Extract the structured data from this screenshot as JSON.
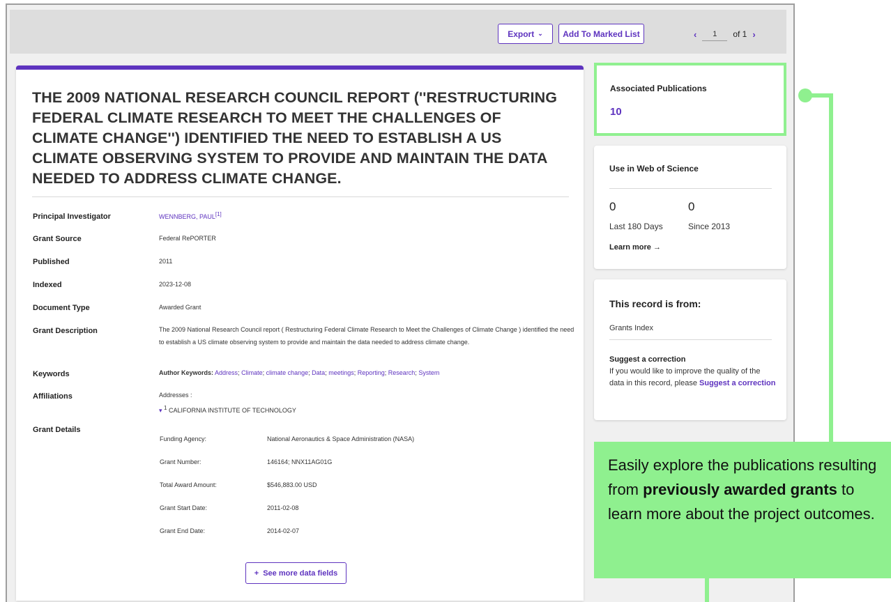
{
  "toolbar": {
    "export_label": "Export",
    "marked_list_label": "Add To Marked List",
    "page_current": "1",
    "page_total": "of 1"
  },
  "record": {
    "title": "THE 2009 NATIONAL RESEARCH COUNCIL REPORT (''RESTRUCTURING FEDERAL CLIMATE RESEARCH TO MEET THE CHALLENGES OF CLIMATE CHANGE'') IDENTIFIED THE NEED TO ESTABLISH A US CLIMATE OBSERVING SYSTEM TO PROVIDE AND MAINTAIN THE DATA NEEDED TO ADDRESS CLIMATE CHANGE.",
    "fields": {
      "pi_label": "Principal Investigator",
      "pi_value": "WENNBERG, PAUL",
      "pi_sup": "[1]",
      "source_label": "Grant Source",
      "source_value": "Federal RePORTER",
      "published_label": "Published",
      "published_value": "2011",
      "indexed_label": "Indexed",
      "indexed_value": "2023-12-08",
      "doctype_label": "Document Type",
      "doctype_value": "Awarded Grant",
      "desc_label": "Grant Description",
      "desc_value": "The 2009 National Research Council report ( Restructuring Federal Climate Research to Meet the Challenges of Climate Change ) identified the need to establish a US climate observing system to provide and maintain the data needed to address climate change.",
      "keywords_label": "Keywords",
      "keywords_prefix": "Author Keywords:",
      "keywords": [
        "Address",
        "Climate",
        "climate change",
        "Data",
        "meetings",
        "Reporting",
        "Research",
        "System"
      ],
      "affiliations_label": "Affiliations",
      "addresses_label": "Addresses :",
      "address_num": "1",
      "address_value": "CALIFORNIA INSTITUTE OF TECHNOLOGY",
      "grant_details_label": "Grant Details"
    },
    "grant_details": {
      "agency_label": "Funding Agency:",
      "agency_value": "National Aeronautics & Space Administration (NASA)",
      "number_label": "Grant Number:",
      "number_value": "146164; NNX11AG01G",
      "amount_label": "Total Award Amount:",
      "amount_value": "$546,883.00 USD",
      "start_label": "Grant Start Date:",
      "start_value": "2011-02-08",
      "end_label": "Grant End Date:",
      "end_value": "2014-02-07"
    },
    "see_more_label": "See more data fields"
  },
  "sidebar": {
    "assoc_title": "Associated Publications",
    "assoc_count": "10",
    "wos_title": "Use in Web of Science",
    "wos_180_value": "0",
    "wos_180_label": "Last 180 Days",
    "wos_since_value": "0",
    "wos_since_label": "Since 2013",
    "learn_more": "Learn more",
    "record_from_title": "This record is from:",
    "record_source": "Grants Index",
    "suggest_title": "Suggest a correction",
    "suggest_text": "If you would like to improve the quality of the data in this record, please",
    "suggest_link": "Suggest a correction"
  },
  "callout": {
    "text_1": "Easily explore the publications resulting from",
    "text_bold": "previously awarded grants",
    "text_2": "to learn more about the project outcomes."
  },
  "colors": {
    "accent": "#5e33bf",
    "highlight_green": "#8ff08f"
  }
}
